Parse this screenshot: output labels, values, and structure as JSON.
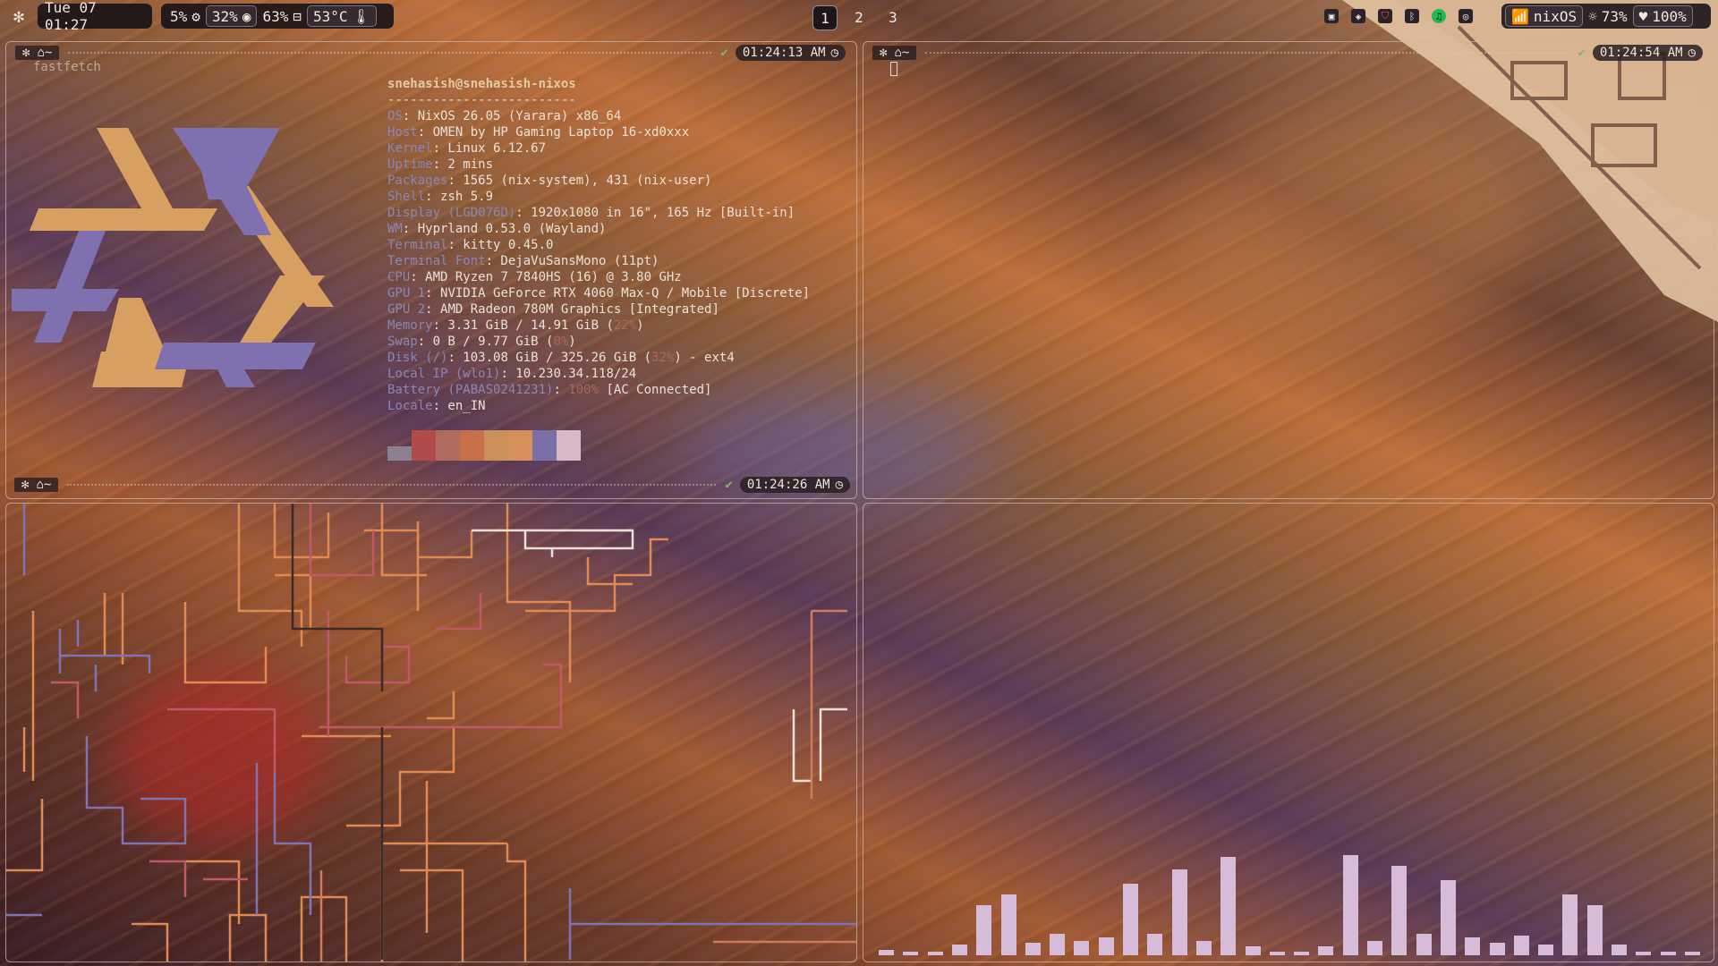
{
  "topbar": {
    "datetime": "Tue 07 01:27",
    "stats": [
      {
        "value": "5%",
        "icon": "cpu-icon"
      },
      {
        "value": "32%",
        "icon": "memory-icon"
      },
      {
        "value": "63%",
        "icon": "disk-icon"
      },
      {
        "value": "53°C",
        "icon": "thermometer-icon"
      }
    ],
    "workspaces": [
      "1",
      "2",
      "3"
    ],
    "active_workspace": "1",
    "network_name": "nixOS",
    "brightness": "73%",
    "battery": "100%"
  },
  "panes": {
    "top_left": {
      "time": "01:24:13 AM",
      "command": "fastfetch",
      "user_host": "snehasish@snehasish-nixos",
      "separator": "-------------------------",
      "info": [
        {
          "key": "OS",
          "value": ": NixOS 26.05 (Yarara) x86_64"
        },
        {
          "key": "Host",
          "value": ": OMEN by HP Gaming Laptop 16-xd0xxx"
        },
        {
          "key": "Kernel",
          "value": ": Linux 6.12.67"
        },
        {
          "key": "Uptime",
          "value": ": 2 mins"
        },
        {
          "key": "Packages",
          "value": ": 1565 (nix-system), 431 (nix-user)"
        },
        {
          "key": "Shell",
          "value": ": zsh 5.9"
        },
        {
          "key": "Display (LGD076D)",
          "value": ": 1920x1080 in 16\", 165 Hz [Built-in]"
        },
        {
          "key": "WM",
          "value": ": Hyprland 0.53.0 (Wayland)"
        },
        {
          "key": "Terminal",
          "value": ": kitty 0.45.0"
        },
        {
          "key": "Terminal Font",
          "value": ": DejaVuSansMono (11pt)"
        },
        {
          "key": "CPU",
          "value": ": AMD Ryzen 7 7840HS (16) @ 3.80 GHz"
        },
        {
          "key": "GPU 1",
          "value": ": NVIDIA GeForce RTX 4060 Max-Q / Mobile [Discrete]"
        },
        {
          "key": "GPU 2",
          "value": ": AMD Radeon 780M Graphics [Integrated]"
        },
        {
          "key": "Memory",
          "value": ": 3.31 GiB / 14.91 GiB (",
          "pct": "22%",
          "tail": ")"
        },
        {
          "key": "Swap",
          "value": ": 0 B / 9.77 GiB (",
          "pct": "0%",
          "tail": ")"
        },
        {
          "key": "Disk (/)",
          "value": ": 103.08 GiB / 325.26 GiB (",
          "pct": "32%",
          "tail": ") - ext4"
        },
        {
          "key": "Local IP (wlo1)",
          "value": ": 10.230.34.118/24"
        },
        {
          "key": "Battery (PABAS0241231)",
          "value": ": ",
          "pct": "100%",
          "tail": " [AC Connected]"
        },
        {
          "key": "Locale",
          "value": ": en_IN"
        }
      ],
      "palette": [
        "#8a8090",
        "#b24a4a",
        "#b06a5e",
        "#c8704a",
        "#c9905a",
        "#d8905a",
        "#7a70a8",
        "#d8b8c8"
      ]
    },
    "top_right": {
      "time": "01:24:54 AM"
    },
    "bottom_left": {
      "time": "01:24:26 AM"
    }
  },
  "colors": {
    "logo_orange": "#d8a060",
    "logo_purple": "#7f70b0",
    "visualizer_bar": "#d6bcd8"
  },
  "visualizer": {
    "levels": [
      0.03,
      0.02,
      0.01,
      0.06,
      0.28,
      0.34,
      0.07,
      0.12,
      0.08,
      0.1,
      0.4,
      0.12,
      0.48,
      0.08,
      0.55,
      0.05,
      0.02,
      0.02,
      0.05,
      0.56,
      0.08,
      0.5,
      0.12,
      0.42,
      0.1,
      0.07,
      0.11,
      0.06,
      0.34,
      0.28,
      0.06,
      0.01,
      0.02,
      0.02
    ]
  }
}
